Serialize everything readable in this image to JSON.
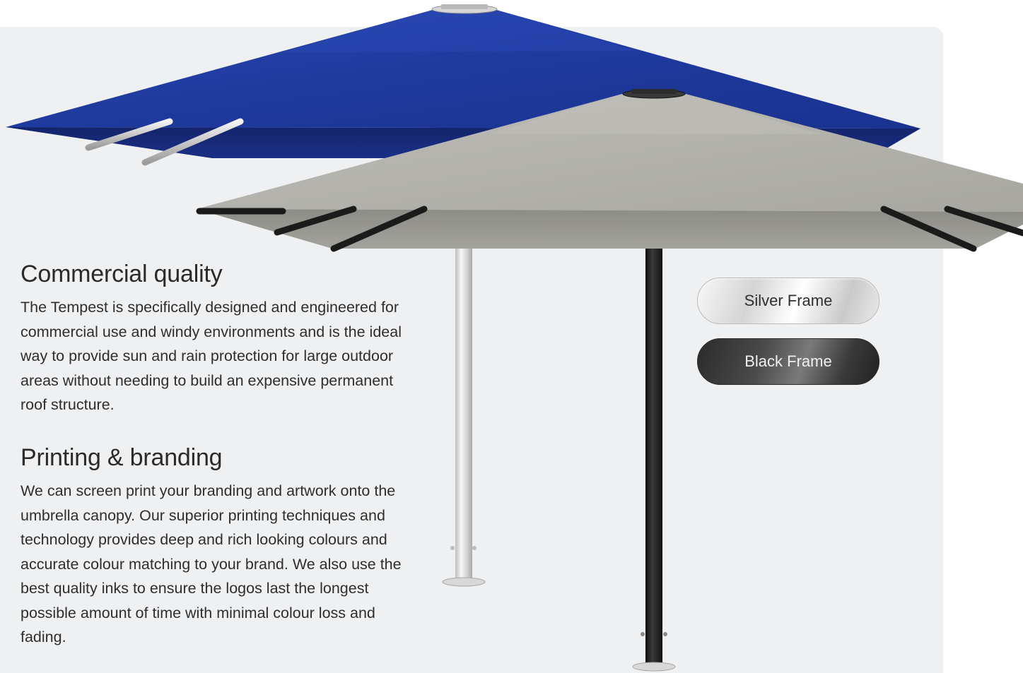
{
  "sections": [
    {
      "heading": "Commercial quality",
      "body": "The Tempest is specifically designed and engineered for commercial use and windy environments and is the ideal way to provide sun and rain protection for large outdoor areas without needing to build an expensive permanent roof structure."
    },
    {
      "heading": "Printing & branding",
      "body": "We can screen print your branding and artwork onto the umbrella canopy. Our superior printing techniques and technology provides deep and rich looking colours and accurate colour matching to your brand. We also use the best quality inks to ensure the logos last the longest possible amount of time with minimal colour loss and fading."
    }
  ],
  "frame_options": {
    "silver_label": "Silver Frame",
    "black_label": "Black Frame"
  },
  "colors": {
    "panel_background": "#eff0f2",
    "blue_canopy": "#1f3a9e",
    "grey_canopy": "#b4b3ad",
    "black_pole": "#1c1c1c",
    "silver_pole": "#dcdcdc"
  },
  "icons": {
    "blue_umbrella": "umbrella-blue-canopy-silver-frame",
    "grey_umbrella": "umbrella-grey-canopy-black-frame"
  }
}
